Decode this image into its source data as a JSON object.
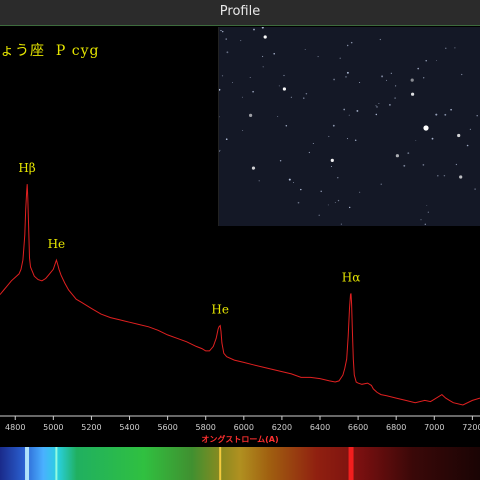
{
  "window": {
    "title": "Profile"
  },
  "header_text": "ょう座  P cyg",
  "chart_data": {
    "type": "line",
    "title": "",
    "xlabel": "オングストローム(A)",
    "ylabel": "",
    "xlim": [
      4720,
      7240
    ],
    "ylim": [
      0,
      1
    ],
    "x_ticks": [
      4800,
      5000,
      5200,
      5400,
      5600,
      5800,
      6000,
      6200,
      6400,
      6600,
      6800,
      7000,
      7200
    ],
    "grid": false,
    "line_color": "#e02020",
    "series": [
      {
        "x": [
          4720,
          4740,
          4760,
          4780,
          4800,
          4820,
          4830,
          4840,
          4845,
          4850,
          4855,
          4860,
          4863,
          4866,
          4870,
          4875,
          4880,
          4890,
          4900,
          4920,
          4940,
          4960,
          4980,
          5000,
          5010,
          5016,
          5020,
          5025,
          5030,
          5040,
          5060,
          5080,
          5100,
          5120,
          5150,
          5200,
          5250,
          5300,
          5350,
          5400,
          5450,
          5500,
          5550,
          5600,
          5650,
          5700,
          5750,
          5780,
          5800,
          5820,
          5840,
          5855,
          5865,
          5870,
          5876,
          5880,
          5885,
          5895,
          5910,
          5950,
          6000,
          6050,
          6100,
          6150,
          6200,
          6250,
          6300,
          6350,
          6400,
          6450,
          6480,
          6500,
          6520,
          6530,
          6540,
          6548,
          6555,
          6560,
          6563,
          6566,
          6570,
          6575,
          6580,
          6590,
          6600,
          6620,
          6650,
          6670,
          6680,
          6700,
          6720,
          6750,
          6800,
          6850,
          6900,
          6950,
          6980,
          7000,
          7040,
          7060,
          7080,
          7100,
          7150,
          7200,
          7240
        ],
        "y": [
          0.48,
          0.5,
          0.52,
          0.54,
          0.555,
          0.57,
          0.59,
          0.63,
          0.68,
          0.74,
          0.85,
          0.93,
          0.96,
          0.9,
          0.78,
          0.64,
          0.6,
          0.58,
          0.56,
          0.545,
          0.54,
          0.55,
          0.57,
          0.59,
          0.615,
          0.63,
          0.62,
          0.605,
          0.59,
          0.565,
          0.53,
          0.5,
          0.48,
          0.46,
          0.445,
          0.42,
          0.395,
          0.38,
          0.37,
          0.36,
          0.35,
          0.34,
          0.325,
          0.305,
          0.29,
          0.275,
          0.255,
          0.245,
          0.235,
          0.235,
          0.255,
          0.29,
          0.33,
          0.34,
          0.345,
          0.32,
          0.27,
          0.225,
          0.21,
          0.195,
          0.185,
          0.175,
          0.165,
          0.155,
          0.145,
          0.135,
          0.12,
          0.12,
          0.115,
          0.105,
          0.1,
          0.105,
          0.13,
          0.16,
          0.2,
          0.3,
          0.42,
          0.48,
          0.485,
          0.44,
          0.32,
          0.2,
          0.13,
          0.1,
          0.095,
          0.09,
          0.095,
          0.085,
          0.07,
          0.055,
          0.045,
          0.04,
          0.03,
          0.02,
          0.01,
          0.02,
          0.015,
          0.025,
          0.045,
          0.03,
          0.02,
          0.01,
          0.0,
          0.02,
          0.03
        ]
      }
    ],
    "annotations": [
      {
        "text": "Hβ",
        "x": 4862,
        "y": 0.96
      },
      {
        "text": "He",
        "x": 5016,
        "y": 0.63
      },
      {
        "text": "He",
        "x": 5876,
        "y": 0.345
      },
      {
        "text": "Hα",
        "x": 6563,
        "y": 0.485
      }
    ]
  }
}
